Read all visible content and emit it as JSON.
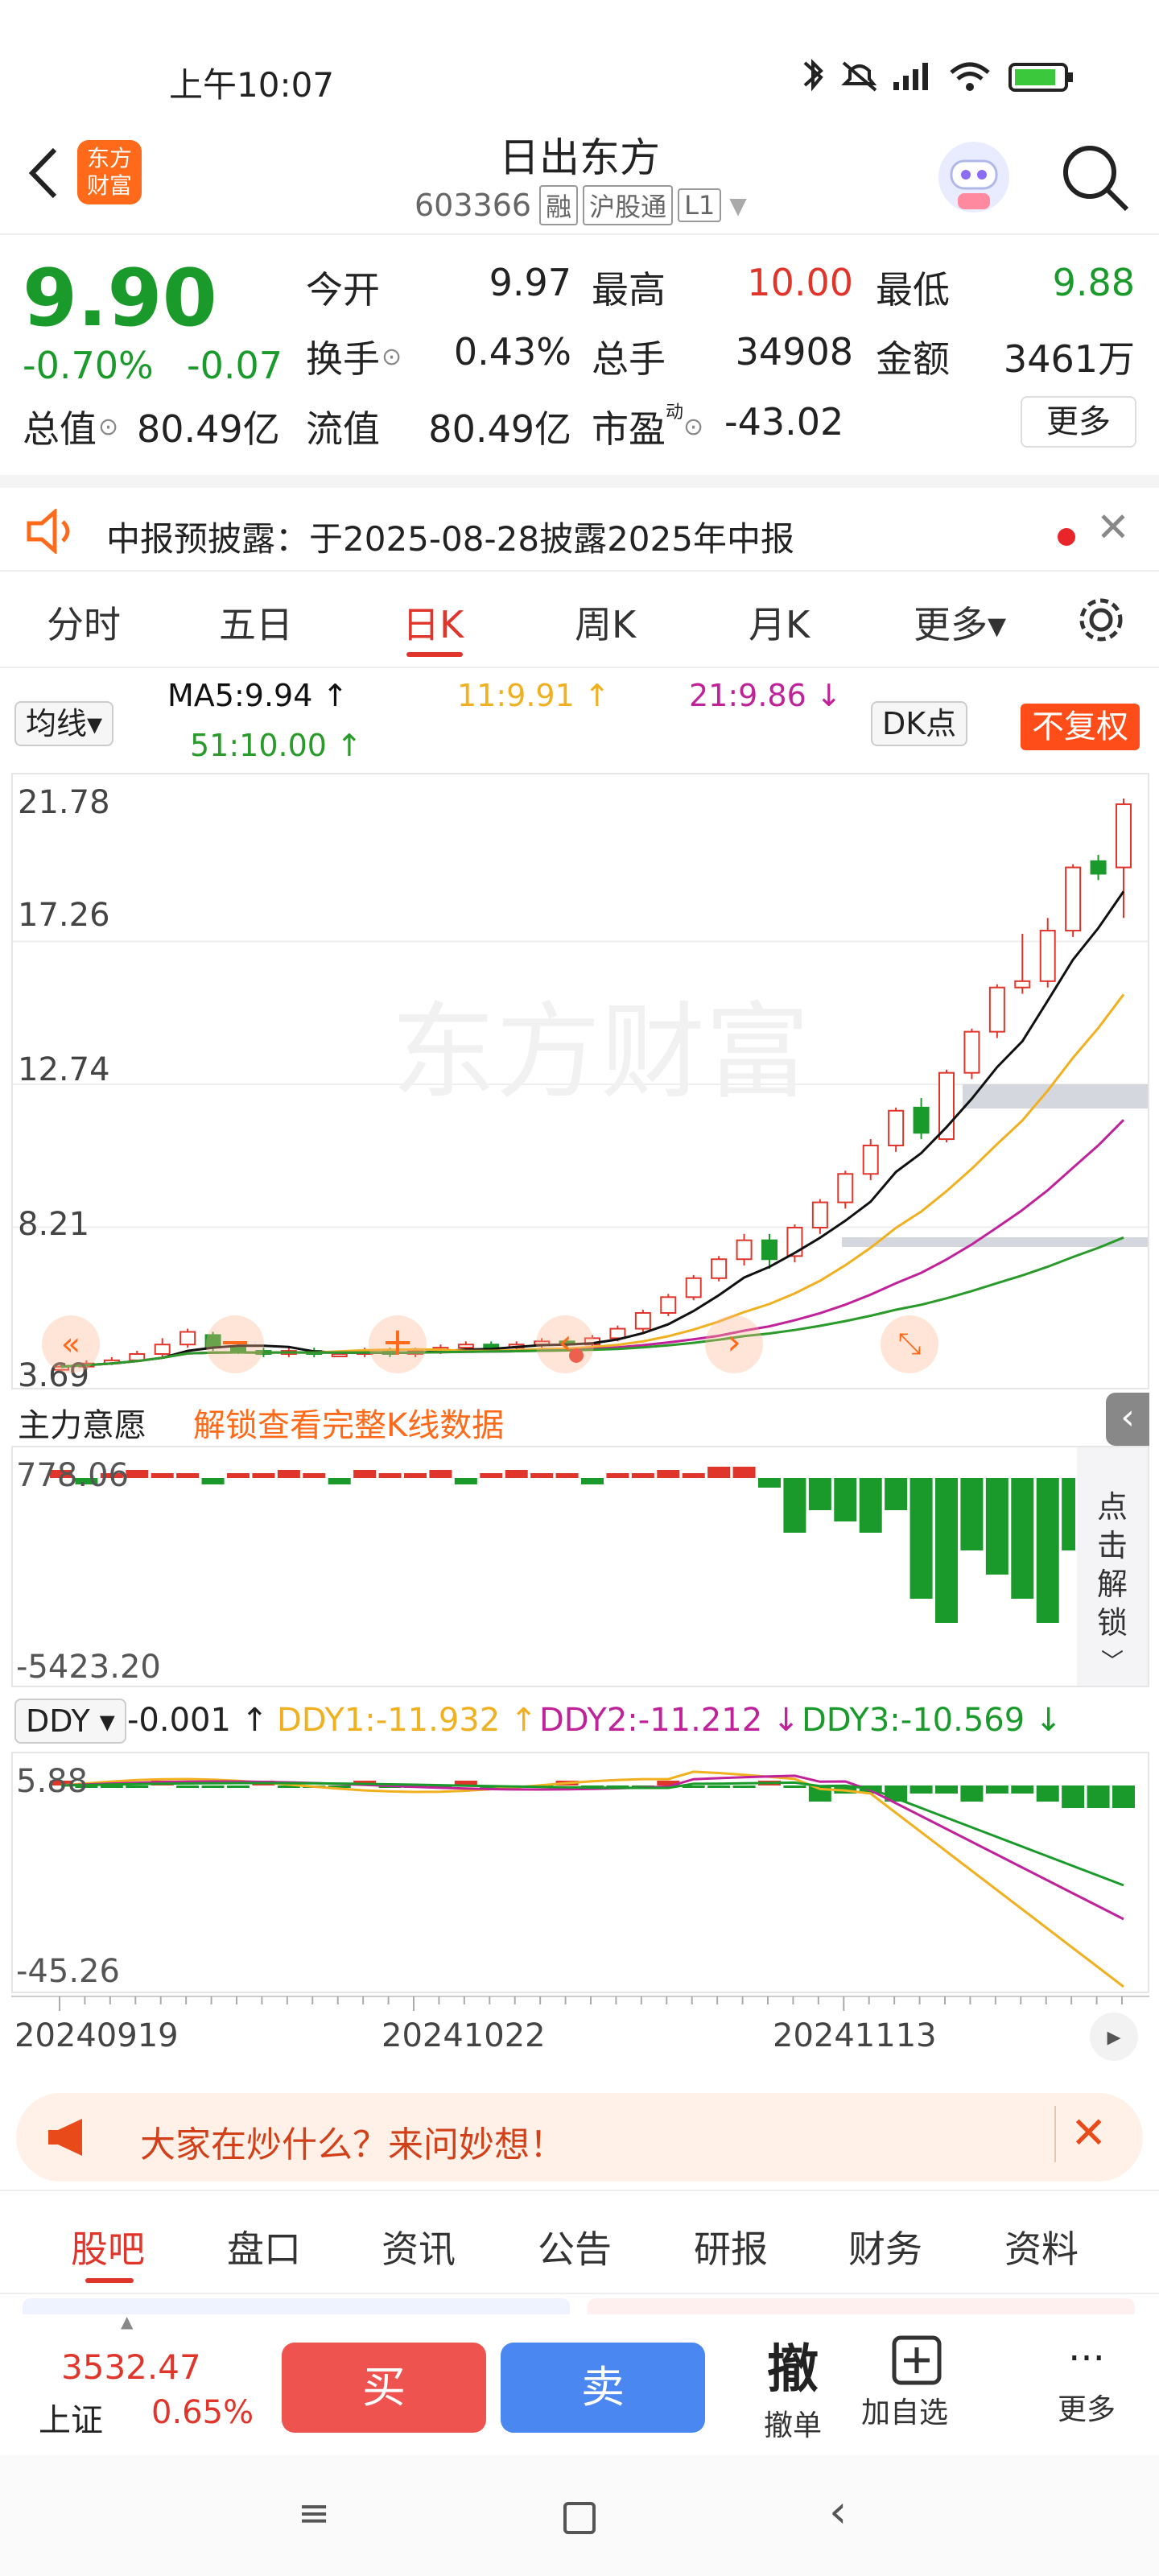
{
  "status": {
    "time": "上午10:07",
    "icons": [
      "bluetooth-icon",
      "mute-icon",
      "signal-icon",
      "wifi-icon",
      "battery-icon"
    ]
  },
  "header": {
    "title": "日出东方",
    "code": "603366",
    "tags": [
      "融",
      "沪股通",
      "L1"
    ],
    "logo_line1": "东方",
    "logo_line2": "财富"
  },
  "quote": {
    "price": "9.90",
    "change_pct": "-0.70%",
    "change": "-0.07",
    "open_label": "今开",
    "open": "9.97",
    "high_label": "最高",
    "high": "10.00",
    "low_label": "最低",
    "low": "9.88",
    "turnover_label": "换手",
    "turnover": "0.43%",
    "volume_label": "总手",
    "volume": "34908",
    "amount_label": "金额",
    "amount": "3461万",
    "mcap_label": "总值",
    "mcap": "80.49亿",
    "float_label": "流值",
    "float": "80.49亿",
    "pe_label": "市盈",
    "pe_sup": "动",
    "pe": "-43.02",
    "more": "更多"
  },
  "notice": {
    "text": "中报预披露：于2025-08-28披露2025年中报"
  },
  "tabs": [
    "分时",
    "五日",
    "日K",
    "周K",
    "月K",
    "更多▾"
  ],
  "active_tab": "日K",
  "indicators": {
    "ma_btn": "均线▾",
    "ma5": "MA5:9.94 ↑",
    "ma11": "11:9.91 ↑",
    "ma21": "21:9.86 ↓",
    "ma51": "51:10.00 ↑",
    "dk": "DK点",
    "fq": "不复权"
  },
  "colors": {
    "up": "#e0352b",
    "down": "#1a9a2a",
    "ma5": "#111111",
    "ma11": "#f0b020",
    "ma21": "#c0229a",
    "ma51": "#2a9a2a"
  },
  "chart_data": {
    "type": "candlestick",
    "price_axis": [
      "21.78",
      "17.26",
      "12.74",
      "8.21",
      "3.69"
    ],
    "ylim": [
      3.69,
      21.78
    ],
    "dates": [
      "20240919",
      "20241022",
      "20241113"
    ],
    "candles": [
      [
        3.7,
        3.8,
        3.9,
        3.65
      ],
      [
        3.8,
        3.9,
        4.0,
        3.7
      ],
      [
        3.9,
        4.0,
        4.1,
        3.85
      ],
      [
        4.0,
        4.2,
        4.3,
        3.95
      ],
      [
        4.2,
        4.5,
        4.7,
        4.1
      ],
      [
        4.5,
        4.9,
        5.0,
        4.4
      ],
      [
        4.8,
        4.4,
        4.9,
        4.3
      ],
      [
        4.4,
        4.3,
        4.5,
        4.2
      ],
      [
        4.3,
        4.2,
        4.4,
        4.1
      ],
      [
        4.2,
        4.3,
        4.4,
        4.1
      ],
      [
        4.3,
        4.2,
        4.4,
        4.1
      ],
      [
        4.2,
        4.2,
        4.3,
        4.1
      ],
      [
        4.2,
        4.3,
        4.4,
        4.1
      ],
      [
        4.3,
        4.2,
        4.4,
        4.1
      ],
      [
        4.2,
        4.3,
        4.4,
        4.1
      ],
      [
        4.3,
        4.4,
        4.5,
        4.2
      ],
      [
        4.4,
        4.5,
        4.6,
        4.3
      ],
      [
        4.5,
        4.4,
        4.6,
        4.3
      ],
      [
        4.4,
        4.5,
        4.6,
        4.3
      ],
      [
        4.5,
        4.6,
        4.7,
        4.4
      ],
      [
        4.6,
        4.5,
        4.7,
        4.4
      ],
      [
        4.5,
        4.7,
        4.8,
        4.4
      ],
      [
        4.7,
        5.0,
        5.1,
        4.6
      ],
      [
        5.0,
        5.5,
        5.6,
        4.9
      ],
      [
        5.5,
        6.0,
        6.1,
        5.4
      ],
      [
        6.0,
        6.6,
        6.7,
        5.9
      ],
      [
        6.6,
        7.2,
        7.3,
        6.5
      ],
      [
        7.2,
        7.8,
        8.0,
        7.0
      ],
      [
        7.8,
        7.2,
        8.0,
        6.9
      ],
      [
        7.3,
        8.2,
        8.3,
        7.1
      ],
      [
        8.2,
        9.0,
        9.1,
        8.0
      ],
      [
        9.0,
        9.9,
        10.0,
        8.8
      ],
      [
        9.9,
        10.8,
        11.0,
        9.7
      ],
      [
        10.8,
        11.9,
        12.0,
        10.6
      ],
      [
        12.0,
        11.2,
        12.3,
        11.0
      ],
      [
        11.0,
        13.1,
        13.2,
        10.9
      ],
      [
        13.1,
        14.4,
        14.5,
        12.9
      ],
      [
        14.4,
        15.8,
        15.9,
        14.2
      ],
      [
        15.8,
        16.0,
        17.5,
        15.6
      ],
      [
        16.0,
        17.6,
        18.0,
        15.8
      ],
      [
        17.6,
        19.6,
        19.7,
        17.4
      ],
      [
        19.8,
        19.4,
        20.0,
        19.2
      ],
      [
        19.6,
        21.6,
        21.78,
        18.0
      ]
    ]
  },
  "flow": {
    "label": "主力意愿",
    "unlock": "解锁查看完整K线数据",
    "top": "778.06",
    "bottom": "-5423.20",
    "side": [
      "点",
      "击",
      "解",
      "锁"
    ]
  },
  "ddy": {
    "label": "DDY",
    "ddy": "-0.001 ↑",
    "ddy1": "DDY1:-11.932 ↑",
    "ddy2": "DDY2:-11.212 ↓",
    "ddy3": "DDY3:-10.569 ↓",
    "top": "5.88",
    "bottom": "-45.26"
  },
  "ask": {
    "text": "大家在炒什么？来问妙想！"
  },
  "bottom_tabs": [
    "股吧",
    "盘口",
    "资讯",
    "公告",
    "研报",
    "财务",
    "资料"
  ],
  "trade": {
    "index_value": "3532.47",
    "index_name": "上证",
    "index_pct": "0.65%",
    "buy": "买",
    "sell": "卖",
    "cancel_big": "撤",
    "cancel": "撤单",
    "add": "加自选",
    "more": "更多"
  },
  "watermark": "东方财富"
}
